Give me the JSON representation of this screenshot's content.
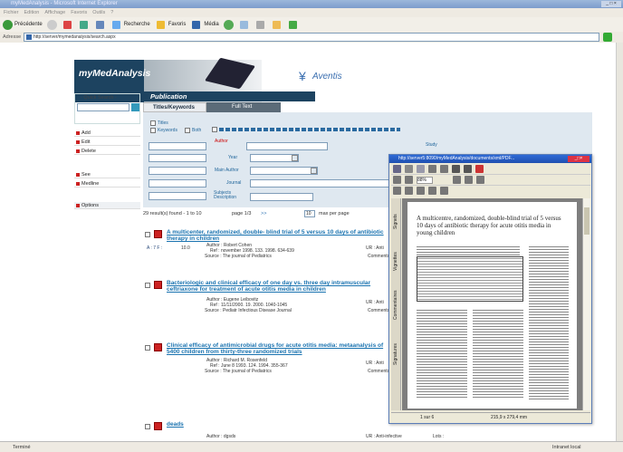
{
  "window": {
    "title": "myMedAnalysis - Microsoft Internet Explorer"
  },
  "menu": [
    "Fichier",
    "Edition",
    "Affichage",
    "Favoris",
    "Outils",
    "?"
  ],
  "toolbar": {
    "back": "Précédente",
    "search": "Recherche",
    "favorites": "Favoris",
    "media": "Média"
  },
  "address": {
    "label": "Adresse",
    "url": "http://server/mymedanalysis/search.aspx"
  },
  "brand": {
    "app_name": "myMedAnalysis",
    "sponsor": "Aventis"
  },
  "sidebar": {
    "quick_search": "Quick Search",
    "items": [
      "Add",
      "Edit",
      "Delete",
      "See",
      "Medline",
      "Options"
    ]
  },
  "main": {
    "section": "Publication",
    "tabs": [
      "Titles/Keywords",
      "Full Text"
    ],
    "keywords_label": "Keywords",
    "both_label": "Both",
    "titles_label": "Titles",
    "form_labels": [
      "Author",
      "Year",
      "Journal",
      "Subject",
      "Main Author",
      "Study",
      "Subjects Description"
    ],
    "results_count": "29 result(s) found - 1 to 10",
    "page_info": "page 1/3",
    "per_page": "10",
    "per_page_label": "max per page"
  },
  "results": [
    {
      "title": "A multicenter, randomized, double- blind trial of 5 versus 10 days of antibiotic therapy in children",
      "score": "10.0",
      "score_prefix": "A : 7 F :",
      "author": "Author : Robert Cohen",
      "ref": "Ref : november 1998. 133. 1998. 634-639",
      "source": "Source : The journal of Pediatrics",
      "ur": "UR : Anti",
      "comment": "Comments"
    },
    {
      "title": "Bacteriologic and clinical efficacy of one day vs. three day intramuscular ceftriaxone for treatment of acute otitis media in children",
      "author": "Author : Eugene Leibovitz",
      "ref": "Ref : 11/11/2000. 19. 2000. 1040-1045",
      "source": "Source : Pediatr Infectious Disease Journal",
      "ur": "UR : Anti",
      "comment": "Comments"
    },
    {
      "title": "Clinical efficacy of antimicrobial drugs for acute otitis media: metaanalysis of 5400 children from thirty-three randomized trials",
      "author": "Author : Richard M. Rosenfeld",
      "ref": "Ref : June 8 1993. 124. 1994. 355-367",
      "source": "Source : The journal of Pediatrics",
      "ur": "UR : Anti",
      "comment": "Comments"
    },
    {
      "title": "deads",
      "author": "Author : dgsds",
      "ref": "Ref :",
      "source": "",
      "ur": "UR : Anti-infective",
      "comment": "Lots :"
    }
  ],
  "pdf": {
    "title": "http://server5:8090/myMedAnalysis/documents/xml/PDF...",
    "zoom": "88%",
    "doc_title": "A multicentre, randomized, double-blind trial of 5 versus 10 days of antibiotic therapy for acute otitis media in young children",
    "page": "1 sur 6",
    "size": "215,9 x 279,4 mm",
    "side_tabs": [
      "Signets",
      "Vignettes",
      "Commentaires",
      "Signatures"
    ]
  },
  "status": {
    "left": "Terminé",
    "right": "Intranet local"
  }
}
